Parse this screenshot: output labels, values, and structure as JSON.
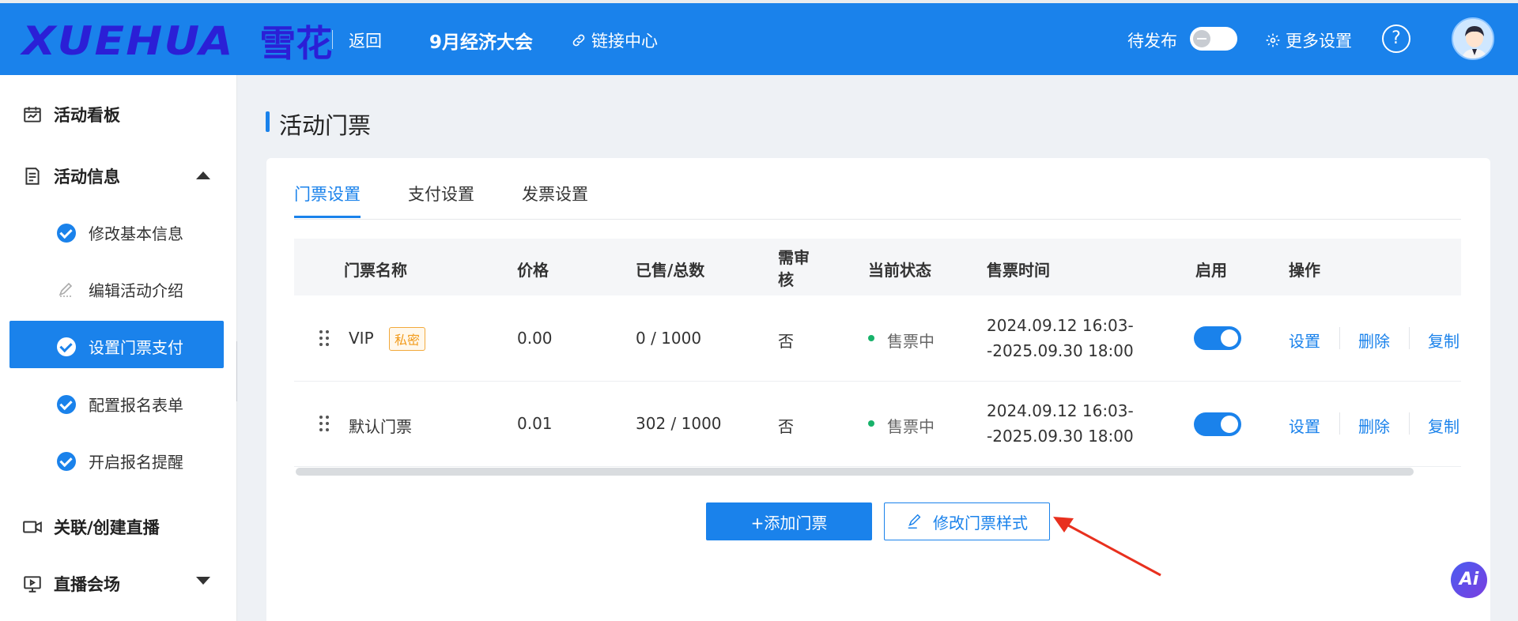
{
  "header": {
    "logo_latin": "XUEHUA",
    "logo_cn": "雪花",
    "back_label": "返回",
    "event_title": "9月经济大会",
    "link_center_label": "链接中心",
    "pending_label": "待发布",
    "more_settings_label": "更多设置",
    "help_symbol": "?"
  },
  "sidebar": {
    "sections": [
      {
        "label": "活动看板",
        "icon": "dashboard-icon"
      },
      {
        "label": "活动信息",
        "icon": "document-icon",
        "expanded": true
      },
      {
        "label": "关联/创建直播",
        "icon": "video-icon"
      },
      {
        "label": "直播会场",
        "icon": "screen-icon",
        "expanded": false
      }
    ],
    "sub_items": [
      {
        "label": "修改基本信息",
        "status": "done"
      },
      {
        "label": "编辑活动介绍",
        "status": "edit"
      },
      {
        "label": "设置门票支付",
        "status": "done",
        "active": true
      },
      {
        "label": "配置报名表单",
        "status": "done"
      },
      {
        "label": "开启报名提醒",
        "status": "done"
      }
    ]
  },
  "page": {
    "title": "活动门票",
    "tabs": [
      {
        "label": "门票设置",
        "active": true
      },
      {
        "label": "支付设置"
      },
      {
        "label": "发票设置"
      }
    ]
  },
  "table": {
    "headers": [
      "门票名称",
      "价格",
      "已售/总数",
      "需审核",
      "当前状态",
      "售票时间",
      "启用",
      "操作"
    ],
    "rows": [
      {
        "name": "VIP",
        "badge": "私密",
        "price": "0.00",
        "sold": "0 / 1000",
        "review": "否",
        "status": "售票中",
        "time_line1": "2024.09.12 16:03-",
        "time_line2": "-2025.09.30 18:00",
        "enabled": true,
        "ops": [
          "设置",
          "删除",
          "复制"
        ]
      },
      {
        "name": "默认门票",
        "badge": "",
        "price": "0.01",
        "sold": "302 / 1000",
        "review": "否",
        "status": "售票中",
        "time_line1": "2024.09.12 16:03-",
        "time_line2": "-2025.09.30 18:00",
        "enabled": true,
        "ops": [
          "设置",
          "删除",
          "复制"
        ]
      }
    ]
  },
  "actions": {
    "add_ticket": "+添加门票",
    "edit_style": "修改门票样式"
  },
  "ai_button": "Ai",
  "colors": {
    "primary": "#1a82eb",
    "status_green": "#17b26a",
    "badge_orange": "#f29b1b",
    "annotation_red": "#e8301e"
  }
}
